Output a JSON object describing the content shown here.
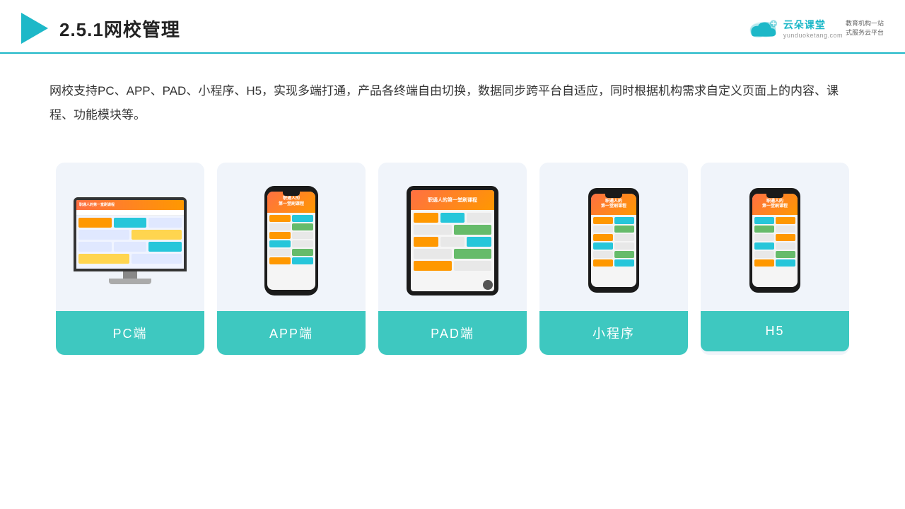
{
  "header": {
    "title": "2.5.1网校管理",
    "logo_main": "云朵课堂",
    "logo_url": "yunduoketang.com",
    "logo_slogan": "教育机构一站\n式服务云平台"
  },
  "description": "网校支持PC、APP、PAD、小程序、H5，实现多端打通，产品各终端自由切换，数据同步跨平台自适应，同时根据机构需求自定义页面上的内容、课程、功能模块等。",
  "cards": [
    {
      "id": "pc",
      "label": "PC端"
    },
    {
      "id": "app",
      "label": "APP端"
    },
    {
      "id": "pad",
      "label": "PAD端"
    },
    {
      "id": "miniapp",
      "label": "小程序"
    },
    {
      "id": "h5",
      "label": "H5"
    }
  ],
  "colors": {
    "accent": "#1db8c8",
    "card_label_bg": "#3ec8c0",
    "card_bg": "#f0f4fa",
    "header_border": "#1db8c8"
  }
}
